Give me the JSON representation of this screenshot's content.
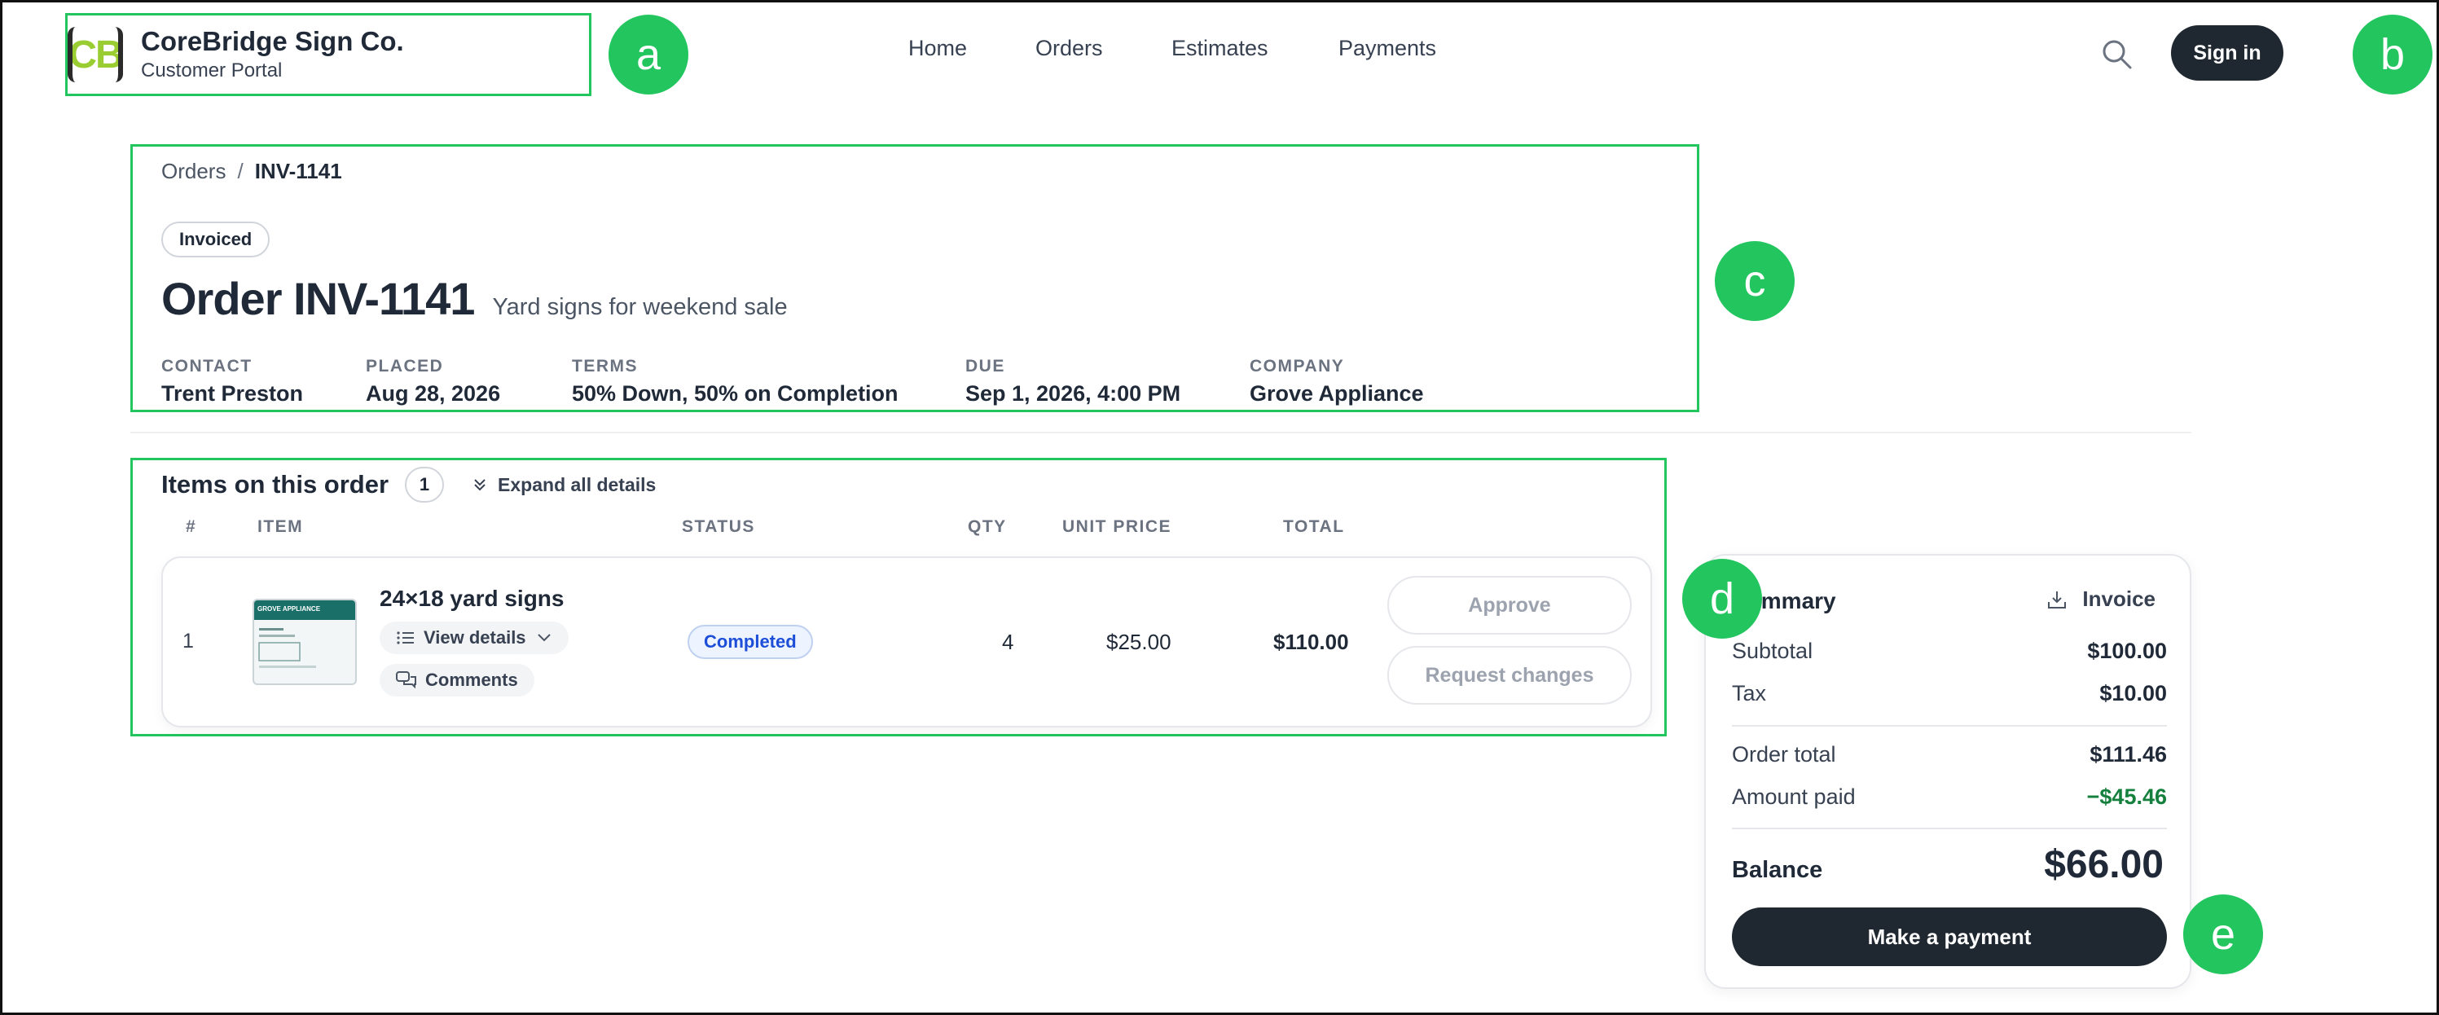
{
  "brand": {
    "logo_text": "CB",
    "name": "CoreBridge Sign Co.",
    "subtitle": "Customer Portal"
  },
  "nav": {
    "items": [
      "Home",
      "Orders",
      "Estimates",
      "Payments"
    ]
  },
  "header": {
    "sign_in_label": "Sign in"
  },
  "annotations": [
    "a",
    "b",
    "c",
    "d",
    "e"
  ],
  "breadcrumb": {
    "parent": "Orders",
    "separator": "/",
    "current": "INV-1141"
  },
  "order": {
    "status": "Invoiced",
    "title": "Order INV-1141",
    "description": "Yard signs for weekend sale",
    "meta": [
      {
        "label": "CONTACT",
        "value": "Trent Preston"
      },
      {
        "label": "PLACED",
        "value": "Aug 28, 2026"
      },
      {
        "label": "TERMS",
        "value": "50% Down, 50% on Completion"
      },
      {
        "label": "DUE",
        "value": "Sep 1, 2026, 4:00 PM"
      },
      {
        "label": "COMPANY",
        "value": "Grove Appliance"
      }
    ]
  },
  "items": {
    "heading": "Items on this order",
    "count": "1",
    "expand_label": "Expand all details",
    "columns": [
      "#",
      "ITEM",
      "STATUS",
      "QTY",
      "UNIT PRICE",
      "TOTAL"
    ],
    "rows": [
      {
        "num": "1",
        "thumb_text": "GROVE APPLIANCE",
        "name": "24×18 yard signs",
        "details_label": "View details",
        "comments_label": "Comments",
        "status": "Completed",
        "qty": "4",
        "unit_price": "$25.00",
        "total": "$110.00",
        "approve_label": "Approve",
        "request_label": "Request changes"
      }
    ]
  },
  "summary": {
    "title": "Summary",
    "invoice_label": "Invoice",
    "subtotal_label": "Subtotal",
    "subtotal": "$100.00",
    "tax_label": "Tax",
    "tax": "$10.00",
    "order_total_label": "Order total",
    "order_total": "$111.46",
    "paid_label": "Amount paid",
    "paid": "−$45.46",
    "balance_label": "Balance",
    "balance": "$66.00",
    "pay_label": "Make a payment"
  },
  "colors": {
    "accent_green": "#22c55e",
    "dark": "#1f2730",
    "link_blue": "#1d4ed8",
    "credit_green": "#15803d"
  }
}
